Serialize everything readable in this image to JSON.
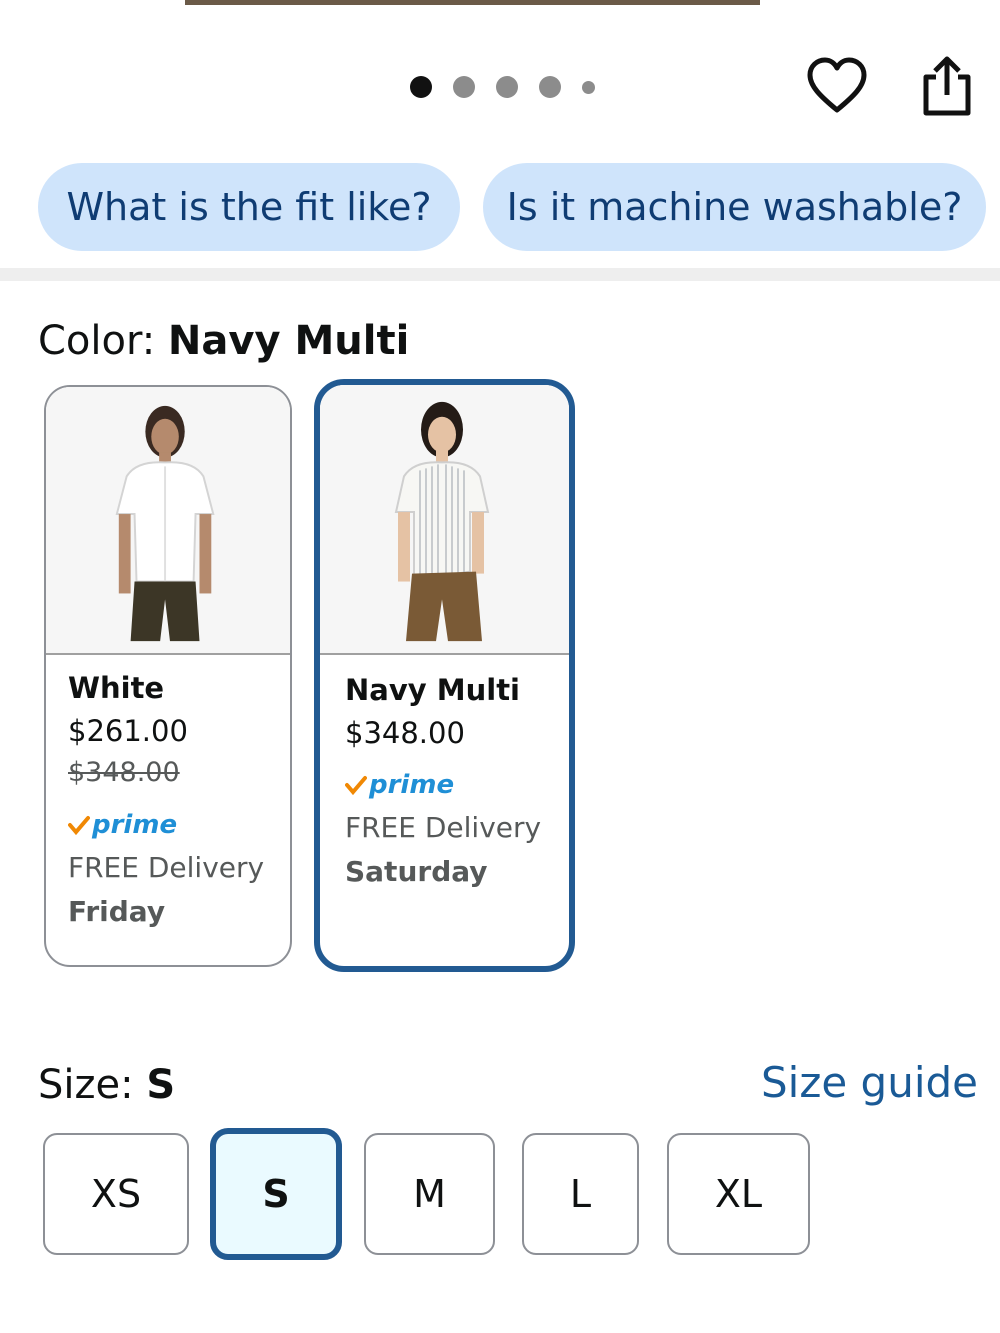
{
  "carousel": {
    "dot_count": 5,
    "active_index": 0
  },
  "actions": {
    "wishlist_icon": "heart-icon",
    "share_icon": "share-icon"
  },
  "questions": [
    {
      "label": "What is the fit like?"
    },
    {
      "label": "Is it machine washable?"
    }
  ],
  "color": {
    "label": "Color: ",
    "selected": "Navy Multi",
    "options": [
      {
        "name": "White",
        "price": "$261.00",
        "list_price": "$348.00",
        "prime": "prime",
        "delivery": "FREE Delivery",
        "day": "Friday",
        "selected": false
      },
      {
        "name": "Navy Multi",
        "price": "$348.00",
        "prime": "prime",
        "delivery": "FREE Delivery",
        "day": "Saturday",
        "selected": true
      }
    ]
  },
  "size": {
    "label": "Size: ",
    "selected": "S",
    "guide_label": "Size guide",
    "options": [
      "XS",
      "S",
      "M",
      "L",
      "XL"
    ]
  },
  "colors": {
    "chip_bg": "#cfe4fb",
    "chip_text": "#0f3c73",
    "selected_border": "#225a92",
    "prime_blue": "#1f8fd6",
    "prime_check": "#f08804",
    "link": "#1a5a96"
  }
}
